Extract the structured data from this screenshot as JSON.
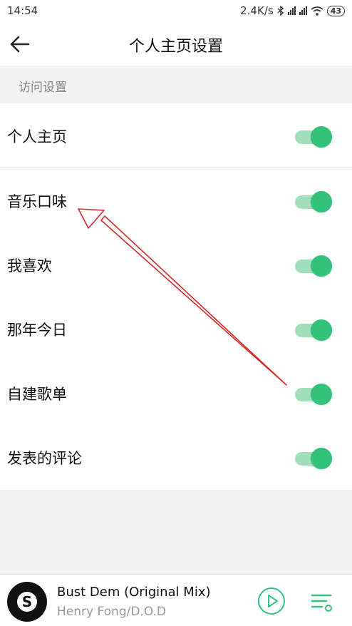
{
  "status": {
    "time": "14:54",
    "network_speed": "2.4K/s",
    "battery": "43",
    "icons": [
      "bluetooth-icon",
      "signal-icon",
      "signal-icon",
      "wifi-icon",
      "battery-icon"
    ]
  },
  "header": {
    "title": "个人主页设置",
    "back_icon": "back-arrow-icon"
  },
  "section": {
    "label": "访问设置"
  },
  "settings": [
    {
      "label": "个人主页",
      "enabled": true
    },
    {
      "label": "音乐口味",
      "enabled": true
    },
    {
      "label": "我喜欢",
      "enabled": true
    },
    {
      "label": "那年今日",
      "enabled": true
    },
    {
      "label": "自建歌单",
      "enabled": true
    },
    {
      "label": "发表的评论",
      "enabled": true
    }
  ],
  "player": {
    "title": "Bust Dem (Original Mix)",
    "artist": "Henry Fong/D.O.D",
    "cover_mark": "S"
  },
  "colors": {
    "accent": "#33c27a",
    "toggle_track": "#9fdfbb",
    "annotation_arrow": "#d42a2a"
  }
}
